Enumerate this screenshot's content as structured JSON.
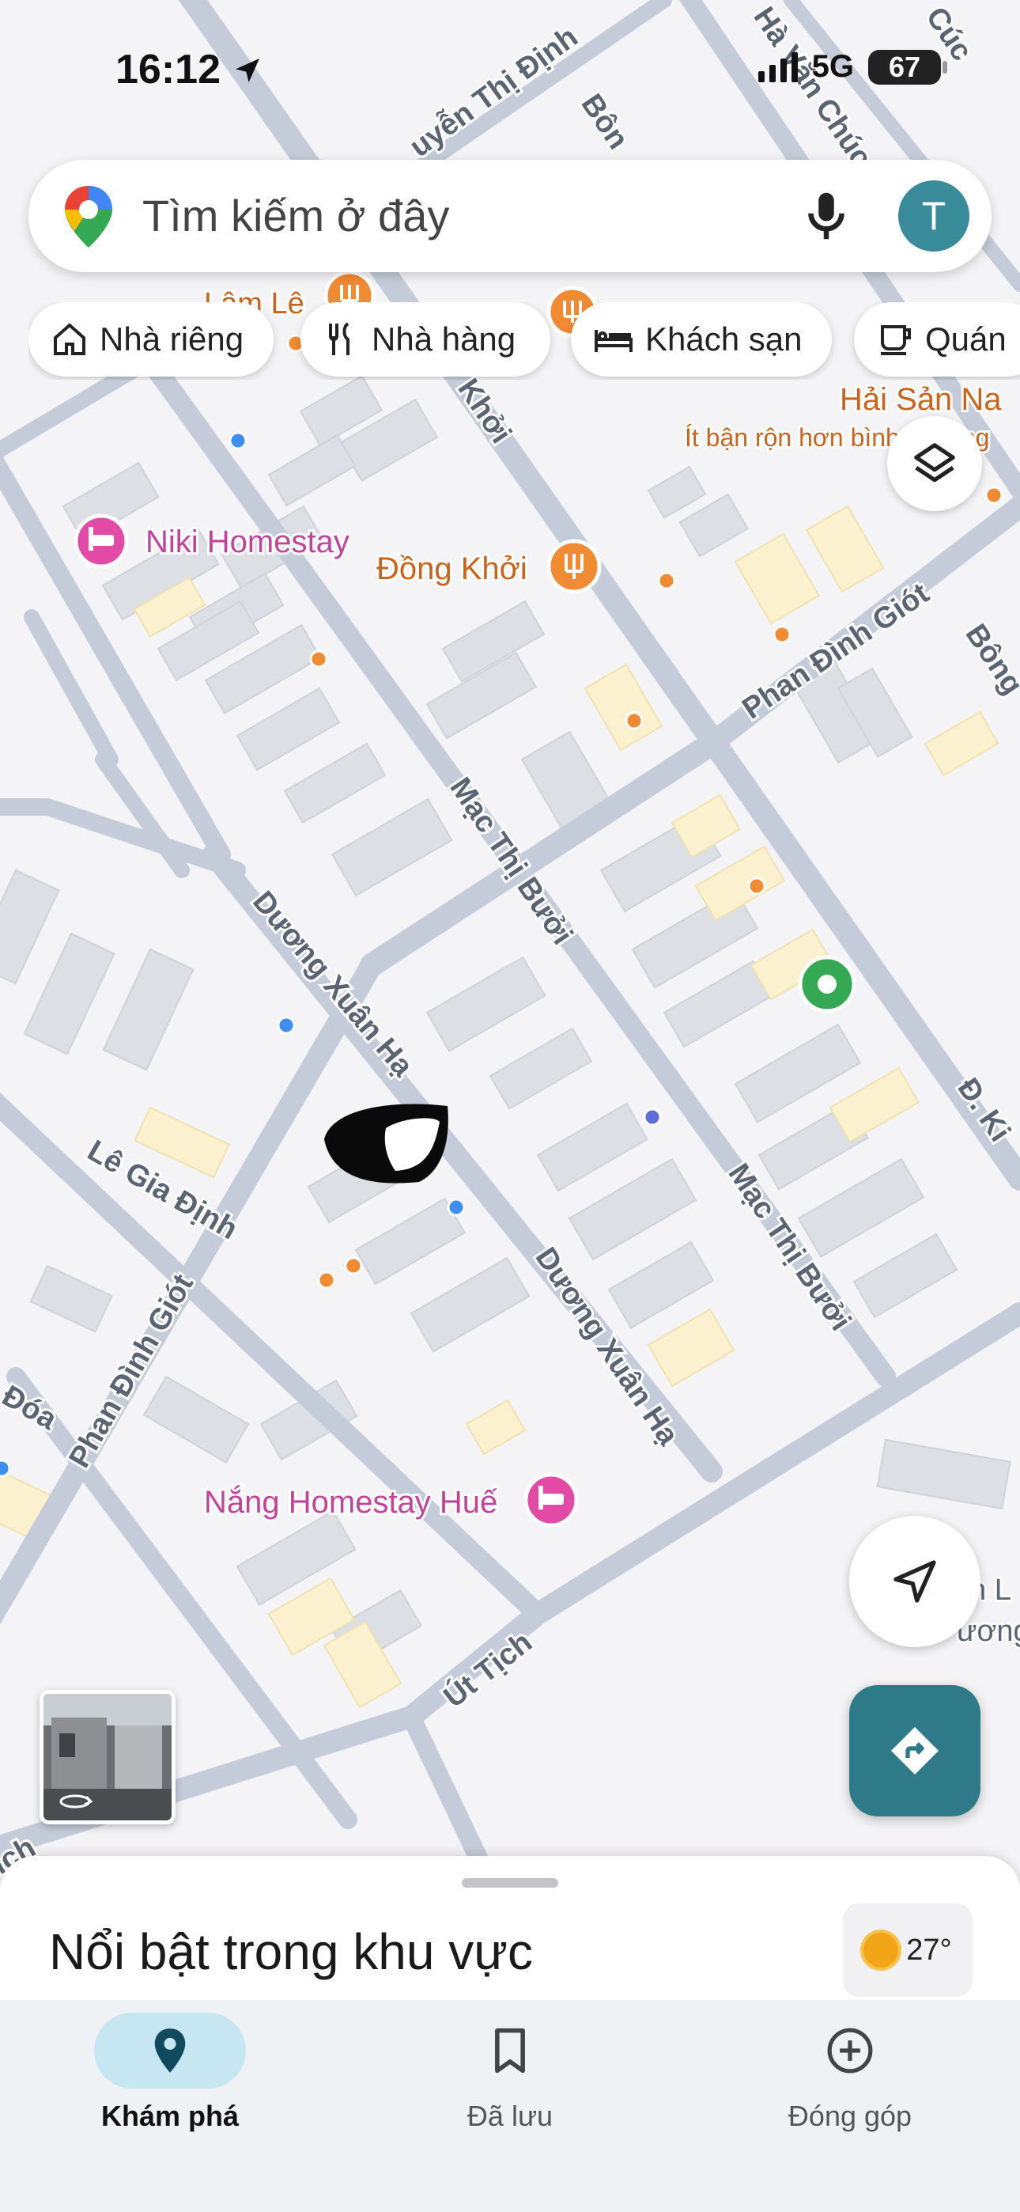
{
  "status_bar": {
    "time": "16:12",
    "network": "5G",
    "battery": "67"
  },
  "search": {
    "placeholder": "Tìm kiếm ở đây",
    "avatar_letter": "T"
  },
  "chips": [
    {
      "label": "Nhà riêng",
      "icon": "home-icon"
    },
    {
      "label": "Nhà hàng",
      "icon": "restaurant-icon"
    },
    {
      "label": "Khách sạn",
      "icon": "hotel-icon"
    },
    {
      "label": "Quán",
      "icon": "cafe-icon"
    }
  ],
  "map": {
    "streets": {
      "nguyen_thi_dinh": "uyễn Thị Định",
      "bon": "Bôn",
      "ha_van_chuc": "Hà Văn Chúc",
      "cuc": "Cúc",
      "dong_khoi": "Khởi",
      "phan_dinh_giot_top": "Phan Đình Giót",
      "bong": "Bông",
      "mac_thi_buoi_1": "Mạc Thị Bưởi",
      "mac_thi_buoi_2": "Mạc Thị Bưởi",
      "duong_xuan_ha_1": "Dương Xuân Hạ",
      "duong_xuan_ha_2": "Dương Xuân Hạ",
      "le_gia_dinh": "Lê Gia Định",
      "phan_dinh_giot_left": "Phan Đình Giót",
      "doa": "Đóa",
      "ut_tich": "Út Tịch",
      "d_ki": "Đ. Ki",
      "ich": "ịch",
      "lam_le": "Lâm Lê",
      "duong_right": "ương",
      "h_l": "h L"
    },
    "places": {
      "niki_homestay": "Niki Homestay",
      "dong_khoi_restaurant": "Đồng Khởi",
      "hai_san_na": "Hải Sản Na",
      "hai_san_na_sub": "Ít bận rộn hơn bình thường",
      "nang_homestay": "Nắng Homestay Huế"
    }
  },
  "sheet": {
    "title": "Nổi bật trong khu vực",
    "temperature": "27°"
  },
  "bottom_nav": [
    {
      "label": "Khám phá",
      "icon": "explore-pin-icon",
      "active": true
    },
    {
      "label": "Đã lưu",
      "icon": "bookmark-icon",
      "active": false
    },
    {
      "label": "Đóng góp",
      "icon": "add-circle-icon",
      "active": false
    }
  ],
  "colors": {
    "road": "#c3ccd8",
    "block": "#d9dce2",
    "block_yellow": "#fbf1cf",
    "poi_orange": "#f08a33",
    "poi_pink": "#e24ba5",
    "poi_blue": "#3e8ef0",
    "accent_teal": "#2f7a89"
  }
}
